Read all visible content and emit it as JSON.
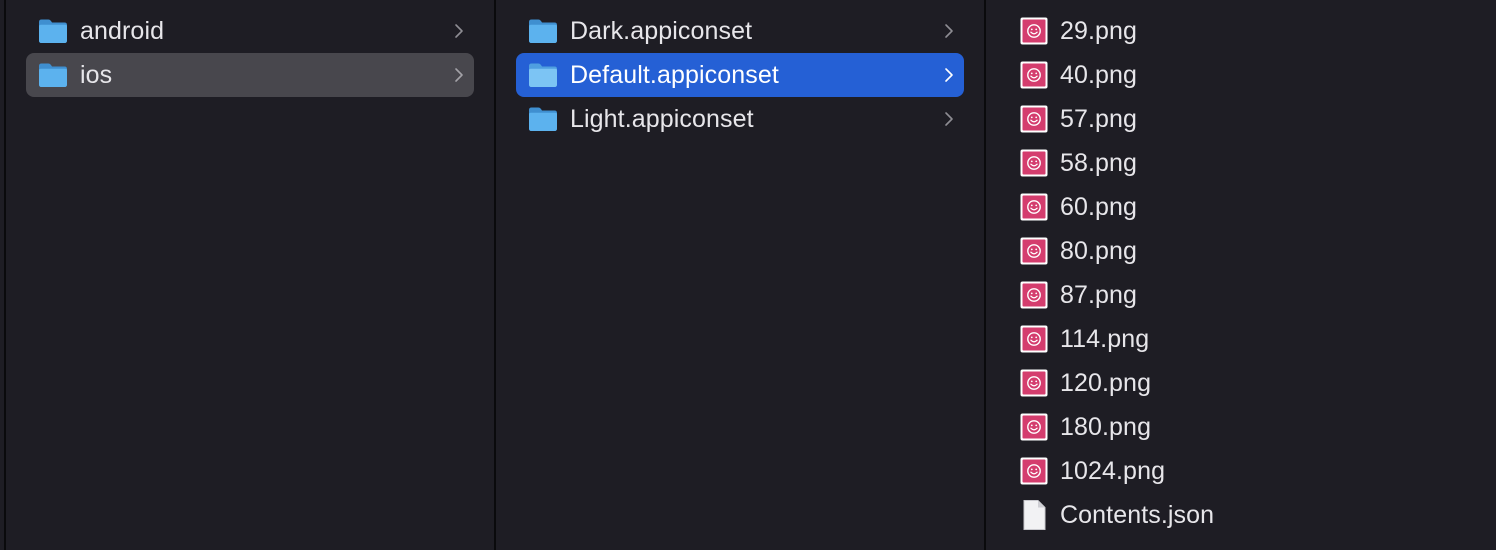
{
  "theme": {
    "background": "#1e1d24",
    "selection_active": "#2560d5",
    "selection_inactive": "#48474d",
    "folder_blue": "#5cb2ee",
    "icon_pink": "#d43d6e"
  },
  "columns": [
    {
      "items": [
        {
          "label": "android",
          "icon": "folder-icon",
          "has_children": true,
          "selected": "none"
        },
        {
          "label": "ios",
          "icon": "folder-icon",
          "has_children": true,
          "selected": "inactive"
        }
      ]
    },
    {
      "items": [
        {
          "label": "Dark.appiconset",
          "icon": "folder-icon",
          "has_children": true,
          "selected": "none"
        },
        {
          "label": "Default.appiconset",
          "icon": "folder-icon",
          "has_children": true,
          "selected": "active"
        },
        {
          "label": "Light.appiconset",
          "icon": "folder-icon",
          "has_children": true,
          "selected": "none"
        }
      ]
    },
    {
      "items": [
        {
          "label": "29.png",
          "icon": "png-image-icon"
        },
        {
          "label": "40.png",
          "icon": "png-image-icon"
        },
        {
          "label": "57.png",
          "icon": "png-image-icon"
        },
        {
          "label": "58.png",
          "icon": "png-image-icon"
        },
        {
          "label": "60.png",
          "icon": "png-image-icon"
        },
        {
          "label": "80.png",
          "icon": "png-image-icon"
        },
        {
          "label": "87.png",
          "icon": "png-image-icon"
        },
        {
          "label": "114.png",
          "icon": "png-image-icon"
        },
        {
          "label": "120.png",
          "icon": "png-image-icon"
        },
        {
          "label": "180.png",
          "icon": "png-image-icon"
        },
        {
          "label": "1024.png",
          "icon": "png-image-icon"
        },
        {
          "label": "Contents.json",
          "icon": "json-document-icon"
        }
      ]
    }
  ]
}
